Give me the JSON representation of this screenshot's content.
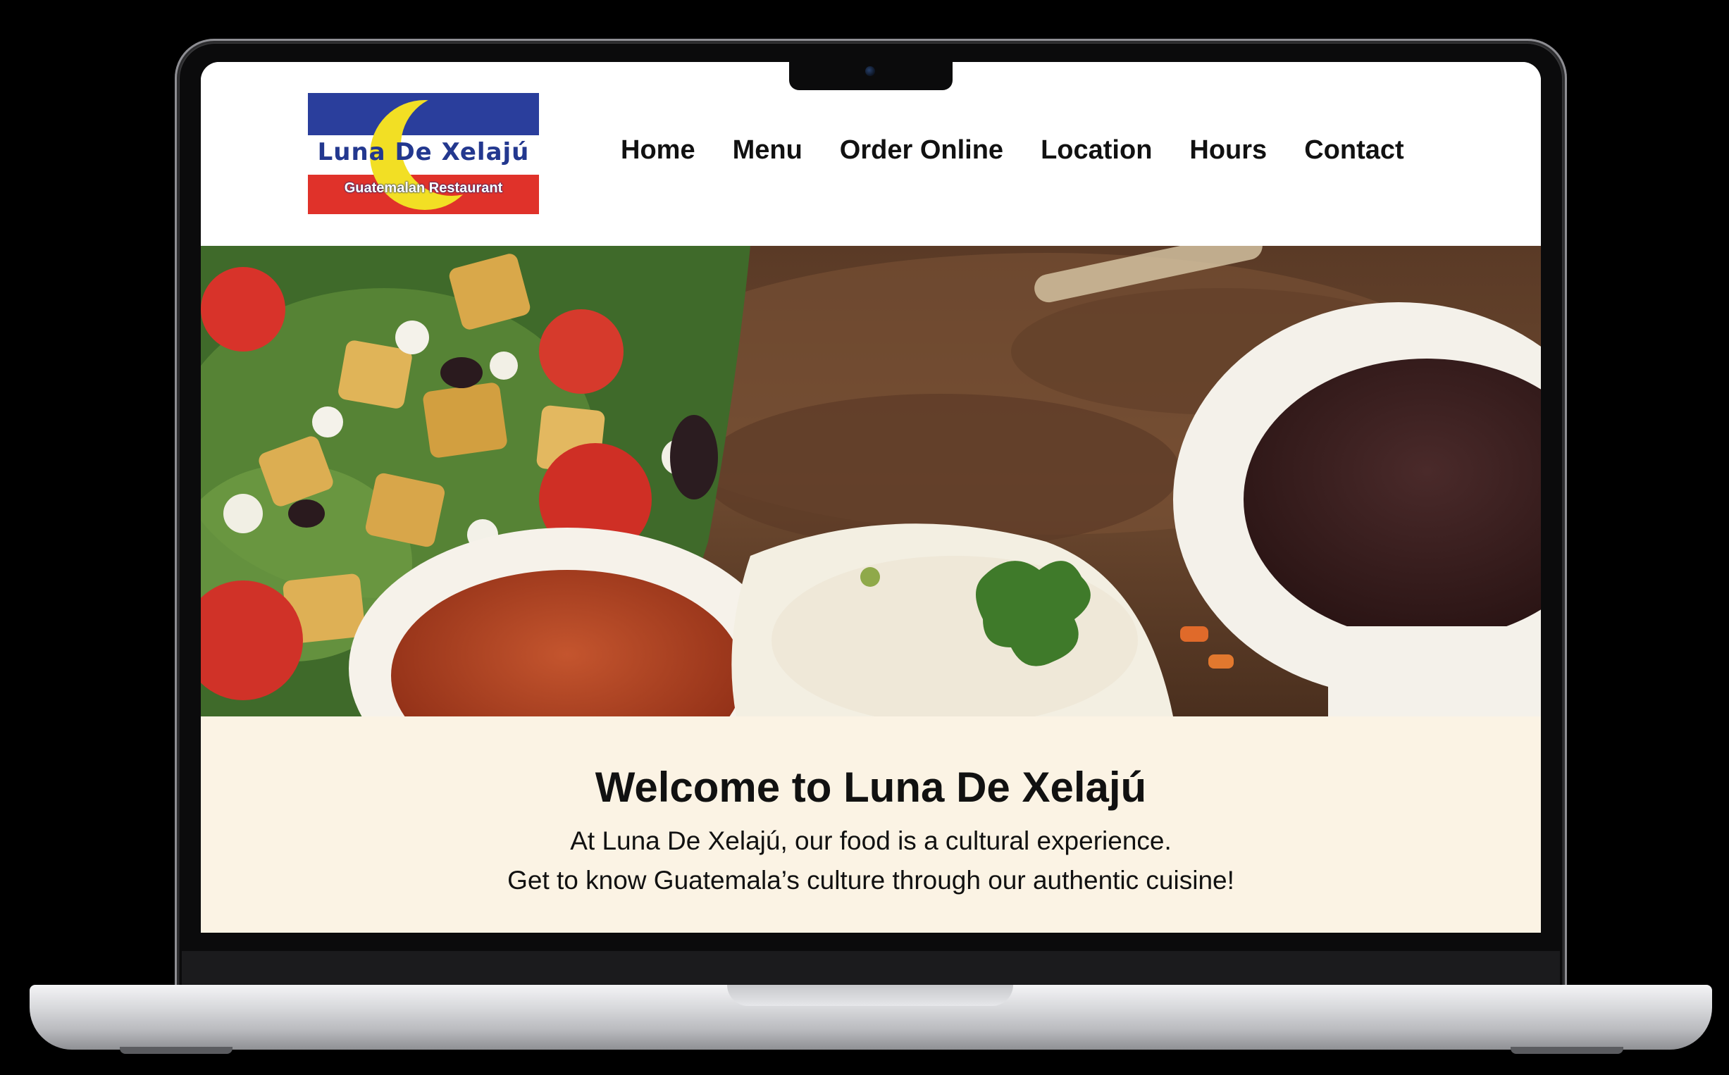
{
  "site": {
    "logo": {
      "name": "Luna De Xelajú",
      "tagline": "Guatemalan Restaurant",
      "colors": {
        "blue": "#2a3e9c",
        "red": "#e0322a",
        "moon": "#f2df24"
      }
    },
    "nav": {
      "items": [
        {
          "label": "Home"
        },
        {
          "label": "Menu"
        },
        {
          "label": "Order Online"
        },
        {
          "label": "Location"
        },
        {
          "label": "Hours"
        },
        {
          "label": "Contact"
        }
      ]
    },
    "hero": {
      "description": "Photo of grilled steak with salad, rice, salsa and black beans"
    },
    "welcome": {
      "heading": "Welcome to Luna De Xelajú",
      "line1": "At Luna De Xelajú, our food is a cultural experience.",
      "line2": "Get to know Guatemala’s culture through our authentic cuisine!",
      "background": "#fbf3e4"
    }
  }
}
